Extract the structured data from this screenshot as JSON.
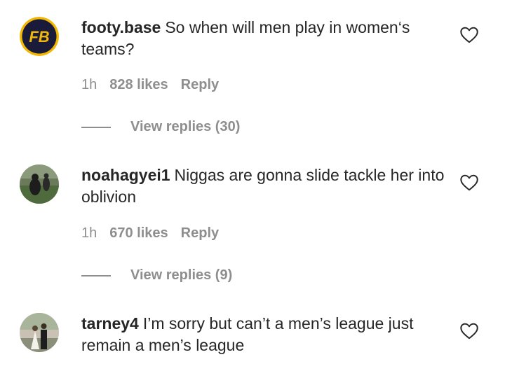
{
  "comments": [
    {
      "username": "footy.base",
      "text": "So when will men play in women‘s teams?",
      "time": "1h",
      "likes": "828 likes",
      "reply_label": "Reply",
      "view_replies": "View replies (30)",
      "avatar_icon": "fb-logo-avatar",
      "liked": false
    },
    {
      "username": "noahagyei1",
      "text": "Niggas are gonna slide tackle her into oblivion",
      "time": "1h",
      "likes": "670 likes",
      "reply_label": "Reply",
      "view_replies": "View replies (9)",
      "avatar_icon": "photo-avatar",
      "liked": false
    },
    {
      "username": "tarney4",
      "text": "I’m sorry but can’t a men’s league just remain a men’s league",
      "avatar_icon": "wedding-photo-avatar",
      "liked": false
    }
  ],
  "icons": {
    "like": "heart-outline-icon"
  },
  "colors": {
    "text": "#262626",
    "secondary": "#8e8e8e",
    "fb_logo_bg": "#1a1a3a",
    "fb_logo_ring": "#f2b705"
  }
}
